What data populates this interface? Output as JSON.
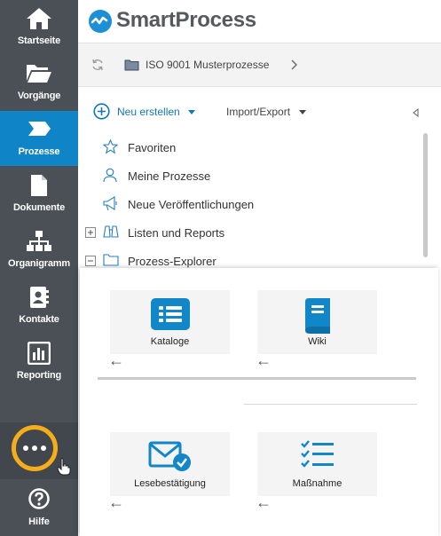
{
  "app": {
    "name": "SmartProcess"
  },
  "sidebar": {
    "items": [
      {
        "label": "Startseite",
        "icon": "home-icon"
      },
      {
        "label": "Vorgänge",
        "icon": "folder-open-icon"
      },
      {
        "label": "Prozesse",
        "icon": "process-chevron-icon",
        "active": true
      },
      {
        "label": "Dokumente",
        "icon": "document-icon"
      },
      {
        "label": "Organigramm",
        "icon": "org-chart-icon"
      },
      {
        "label": "Kontakte",
        "icon": "contact-card-icon"
      },
      {
        "label": "Reporting",
        "icon": "bar-chart-icon"
      }
    ],
    "more_icon": "more-dots-icon",
    "help": {
      "label": "Hilfe",
      "icon": "help-circle-icon"
    }
  },
  "breadcrumb": {
    "label": "ISO 9001 Musterprozesse"
  },
  "toolbar": {
    "new_label": "Neu erstellen",
    "import_export_label": "Import/Export"
  },
  "tree": {
    "items": [
      {
        "label": "Favoriten",
        "icon": "star-icon"
      },
      {
        "label": "Meine Prozesse",
        "icon": "user-icon"
      },
      {
        "label": "Neue Veröffentlichungen",
        "icon": "megaphone-icon"
      },
      {
        "label": "Listen und Reports",
        "icon": "binoculars-icon",
        "expander": "+"
      },
      {
        "label": "Prozess-Explorer",
        "icon": "folder-icon",
        "expander": "−"
      }
    ]
  },
  "popup": {
    "tiles": [
      {
        "label": "Kataloge",
        "icon": "list-icon"
      },
      {
        "label": "Wiki",
        "icon": "book-icon"
      },
      {
        "label": "Lesebestätigung",
        "icon": "mail-check-icon"
      },
      {
        "label": "Maßnahme",
        "icon": "checklist-icon"
      }
    ],
    "back_arrow": "←"
  },
  "colors": {
    "sidebar": "#4a5056",
    "active": "#0f84c6",
    "accent": "#1277b8",
    "highlight_ring": "#f5ad1b"
  }
}
